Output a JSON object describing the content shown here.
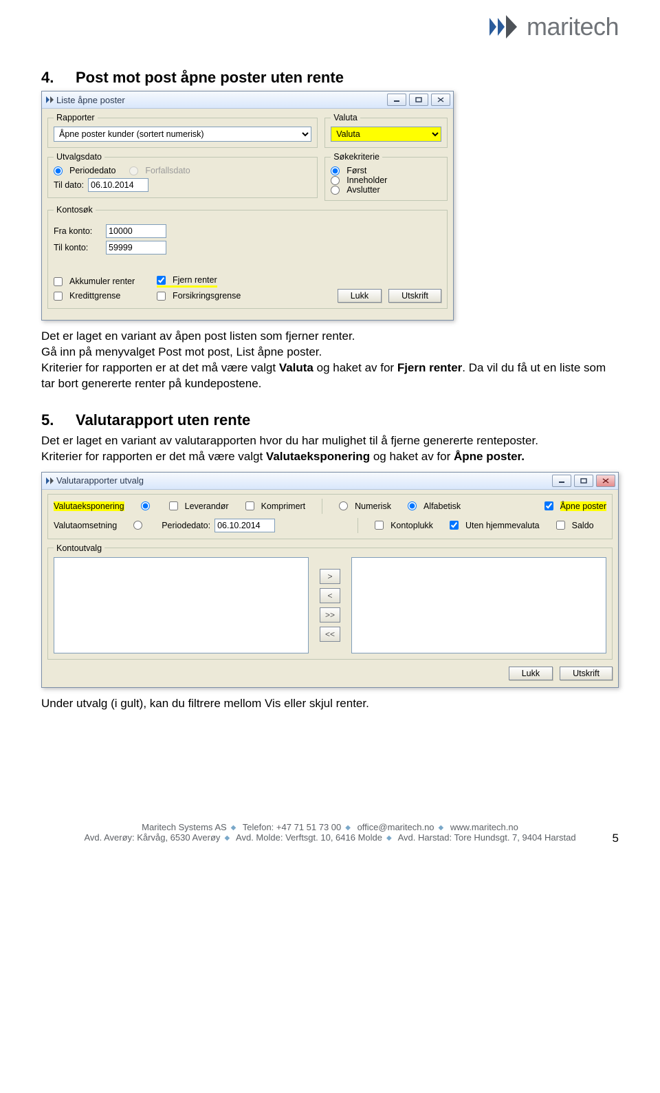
{
  "logo": {
    "text": "maritech"
  },
  "section4": {
    "number": "4.",
    "title": "Post mot post åpne poster uten rente"
  },
  "dlg1": {
    "title": "Liste åpne poster",
    "groups": {
      "rapporter": "Rapporter",
      "valuta": "Valuta",
      "utvalgsdato": "Utvalgsdato",
      "sokekriterie": "Søkekriterie",
      "kontosok": "Kontosøk"
    },
    "rapporter_value": "Åpne poster kunder (sortert numerisk)",
    "valuta_value": "Valuta",
    "radio_periodedato": "Periodedato",
    "radio_forfallsdato": "Forfallsdato",
    "til_dato_label": "Til dato:",
    "til_dato_value": "06.10.2014",
    "radio_forst": "Først",
    "radio_inneholder": "Inneholder",
    "radio_avslutter": "Avslutter",
    "fra_konto_label": "Fra konto:",
    "fra_konto_value": "10000",
    "til_konto_label": "Til konto:",
    "til_konto_value": "59999",
    "cb_akkumuler": "Akkumuler renter",
    "cb_fjern": "Fjern renter",
    "cb_kredittgrense": "Kredittgrense",
    "cb_forsikring": "Forsikringsgrense",
    "btn_lukk": "Lukk",
    "btn_utskrift": "Utskrift"
  },
  "para4": {
    "l1": "Det er laget en variant av åpen post listen som fjerner renter.",
    "l2a": "Gå inn på menyvalget Post mot post, List åpne poster.",
    "l3a": "Kriterier for rapporten er at det må være valgt ",
    "l3b": "Valuta",
    "l3c": " og haket av for ",
    "l3d": "Fjern renter",
    "l3e": ". Da vil du få ut en liste som tar bort genererte renter på kundepostene."
  },
  "section5": {
    "number": "5.",
    "title": "Valutarapport uten rente"
  },
  "para5": {
    "l1": "Det er laget en variant av valutarapporten hvor du har mulighet til å fjerne genererte renteposter.",
    "l2a": "Kriterier for rapporten er det må være valgt ",
    "l2b": "Valutaeksponering",
    "l2c": " og haket av for ",
    "l2d": "Åpne poster.",
    "l2e": ""
  },
  "dlg2": {
    "title": "Valutarapporter utvalg",
    "opt_valutaeksponering": "Valutaeksponering",
    "opt_valutaomsetning": "Valutaomsetning",
    "cb_leverandor": "Leverandør",
    "periodedato_label": "Periodedato:",
    "periodedato_value": "06.10.2014",
    "cb_komprimert": "Komprimert",
    "rad_numerisk": "Numerisk",
    "rad_alfabetisk": "Alfabetisk",
    "cb_kontoplukk": "Kontoplukk",
    "cb_uten_hjemmevaluta": "Uten hjemmevaluta",
    "cb_apne_poster": "Åpne poster",
    "cb_saldo": "Saldo",
    "kontoutvalg": "Kontoutvalg",
    "btn_lukk": "Lukk",
    "btn_utskrift": "Utskrift"
  },
  "para6": "Under utvalg (i gult), kan du filtrere mellom Vis eller skjul renter.",
  "footer": {
    "line1_a": "Maritech Systems AS",
    "line1_b": "Telefon: +47 71 51 73 00",
    "line1_c": "office@maritech.no",
    "line1_d": "www.maritech.no",
    "line2_a": "Avd. Averøy: Kårvåg, 6530 Averøy",
    "line2_b": "Avd. Molde: Verftsgt. 10, 6416 Molde",
    "line2_c": "Avd. Harstad: Tore Hundsgt. 7, 9404 Harstad",
    "page": "5"
  }
}
